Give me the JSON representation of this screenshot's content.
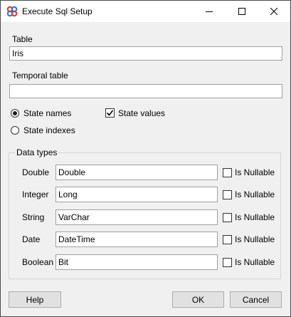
{
  "window": {
    "title": "Execute Sql Setup"
  },
  "table_field": {
    "label": "Table",
    "value": "Iris"
  },
  "temporal_field": {
    "label": "Temporal table",
    "value": ""
  },
  "state_mode": {
    "names_label": "State names",
    "names_selected": true,
    "indexes_label": "State indexes",
    "indexes_selected": false,
    "values_label": "State values",
    "values_checked": true
  },
  "data_types": {
    "title": "Data types",
    "nullable_label": "Is Nullable",
    "rows": [
      {
        "type": "Double",
        "sql": "Double",
        "nullable": false
      },
      {
        "type": "Integer",
        "sql": "Long",
        "nullable": false
      },
      {
        "type": "String",
        "sql": "VarChar",
        "nullable": false
      },
      {
        "type": "Date",
        "sql": "DateTime",
        "nullable": false
      },
      {
        "type": "Boolean",
        "sql": "Bit",
        "nullable": false
      }
    ]
  },
  "buttons": {
    "help": "Help",
    "ok": "OK",
    "cancel": "Cancel"
  }
}
